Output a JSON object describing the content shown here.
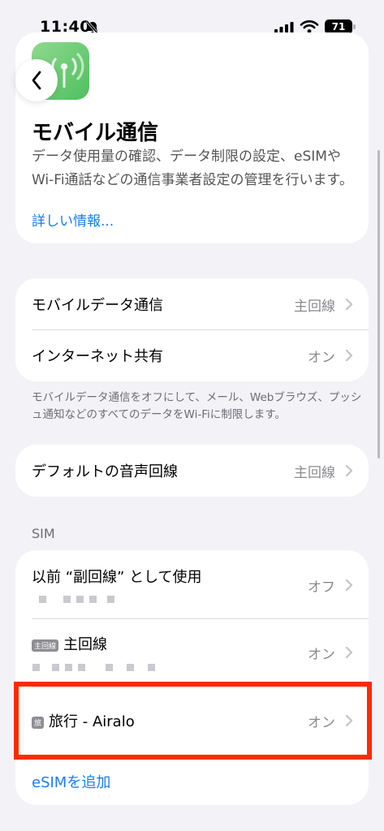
{
  "status": {
    "time": "11:40",
    "battery": "71"
  },
  "header": {
    "title": "モバイル通信",
    "description": "データ使用量の確認、データ制限の設定、eSIMやWi-Fi通話などの通信事業者設定の管理を行います。",
    "link": "詳しい情報..."
  },
  "group1": {
    "rows": [
      {
        "label": "モバイルデータ通信",
        "value": "主回線"
      },
      {
        "label": "インターネット共有",
        "value": "オン"
      }
    ],
    "footnote": "モバイルデータ通信をオフにして、メール、Webブラウズ、プッシュ通知などのすべてのデータをWi-Fiに制限します。"
  },
  "group2": {
    "rows": [
      {
        "label": "デフォルトの音声回線",
        "value": "主回線"
      }
    ]
  },
  "sim": {
    "section_title": "SIM",
    "rows": [
      {
        "label": "以前 “副回線” として使用",
        "value": "オフ"
      },
      {
        "tag": "主回線",
        "label": "主回線",
        "value": "オン"
      },
      {
        "tag": "旅",
        "label": "旅行 - Airalo",
        "value": "オン"
      }
    ],
    "add_esim": "eSIMを追加"
  },
  "colors": {
    "accent": "#1a7cf5",
    "highlight": "#ff2a00"
  }
}
